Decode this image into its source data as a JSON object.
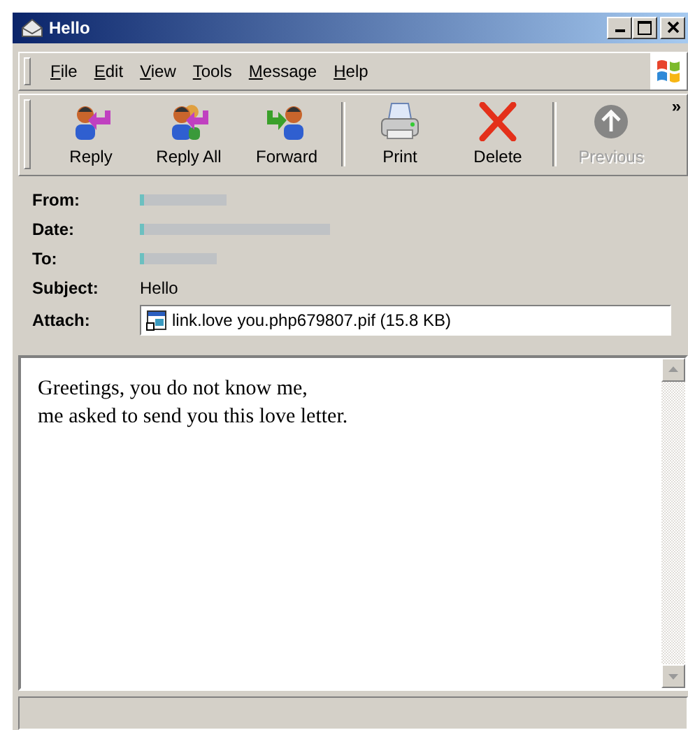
{
  "window": {
    "title": "Hello"
  },
  "menu": [
    {
      "label": "File"
    },
    {
      "label": "Edit"
    },
    {
      "label": "View"
    },
    {
      "label": "Tools"
    },
    {
      "label": "Message"
    },
    {
      "label": "Help"
    }
  ],
  "toolbar": [
    {
      "label": "Reply",
      "kind": "reply",
      "disabled": false
    },
    {
      "label": "Reply All",
      "kind": "reply_all",
      "disabled": false
    },
    {
      "label": "Forward",
      "kind": "forward",
      "disabled": false
    },
    {
      "label": "Print",
      "kind": "print",
      "disabled": false
    },
    {
      "label": "Delete",
      "kind": "delete",
      "disabled": false
    },
    {
      "label": "Previous",
      "kind": "previous",
      "disabled": true
    }
  ],
  "toolbar_overflow": "»",
  "headers": [
    {
      "label": "From:",
      "kind": "blurred"
    },
    {
      "label": "Date:",
      "kind": "blurred"
    },
    {
      "label": "To:",
      "kind": "blurred"
    },
    {
      "label": "Subject:",
      "kind": "text",
      "value": "Hello"
    },
    {
      "label": "Attach:",
      "kind": "attachment",
      "value": "link.love you.php679807.pif (15.8 KB)"
    }
  ],
  "body": [
    "Greetings, you do not know me,",
    "me asked to send you this love letter."
  ]
}
